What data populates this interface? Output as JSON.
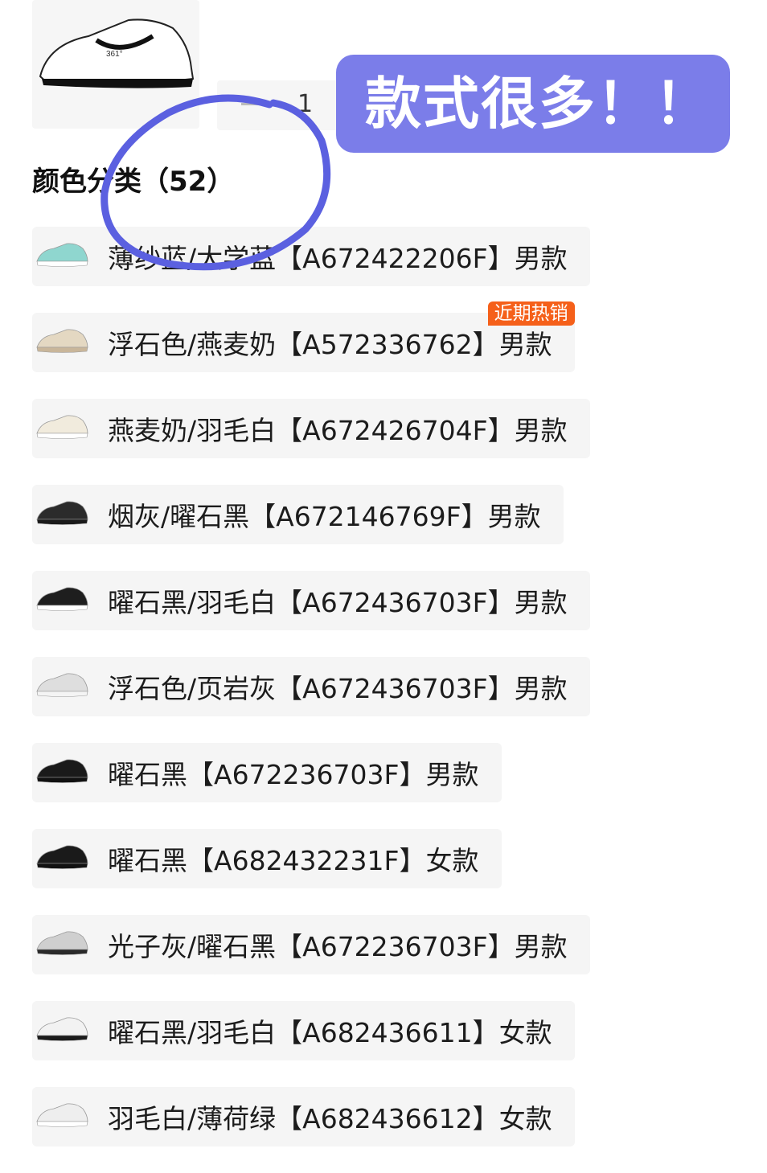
{
  "product": {
    "quantity": "1"
  },
  "banner": {
    "text": "款式很多！！"
  },
  "colors": {
    "title": "颜色分类（52）"
  },
  "variants": [
    {
      "label": "薄纱蓝/大学蓝【A672422206F】男款",
      "shoe_color": "#8fd6cf",
      "sole_color": "#ffffff",
      "hot": false
    },
    {
      "label": "浮石色/燕麦奶【A572336762】男款",
      "shoe_color": "#e4d8c2",
      "sole_color": "#c9b69a",
      "hot": true,
      "badge": "近期热销"
    },
    {
      "label": "燕麦奶/羽毛白【A672426704F】男款",
      "shoe_color": "#f1ebdd",
      "sole_color": "#ffffff",
      "hot": false
    },
    {
      "label": "烟灰/曜石黑【A672146769F】男款",
      "shoe_color": "#2b2b2b",
      "sole_color": "#1a1a1a",
      "hot": false
    },
    {
      "label": "曜石黑/羽毛白【A672436703F】男款",
      "shoe_color": "#1e1e1e",
      "sole_color": "#ffffff",
      "hot": false
    },
    {
      "label": "浮石色/页岩灰【A672436703F】男款",
      "shoe_color": "#dedede",
      "sole_color": "#f4f4f4",
      "hot": false
    },
    {
      "label": "曜石黑【A672236703F】男款",
      "shoe_color": "#1a1a1a",
      "sole_color": "#111111",
      "hot": false
    },
    {
      "label": "曜石黑【A682432231F】女款",
      "shoe_color": "#1a1a1a",
      "sole_color": "#111111",
      "hot": false
    },
    {
      "label": "光子灰/曜石黑【A672236703F】男款",
      "shoe_color": "#cfcfcf",
      "sole_color": "#2a2a2a",
      "hot": false
    },
    {
      "label": "曜石黑/羽毛白【A682436611】女款",
      "shoe_color": "#f2f2f2",
      "sole_color": "#1a1a1a",
      "hot": false
    },
    {
      "label": "羽毛白/薄荷绿【A682436612】女款",
      "shoe_color": "#eeeeee",
      "sole_color": "#ffffff",
      "hot": false
    }
  ],
  "annotation": {
    "circle_color": "#5b60e0"
  }
}
